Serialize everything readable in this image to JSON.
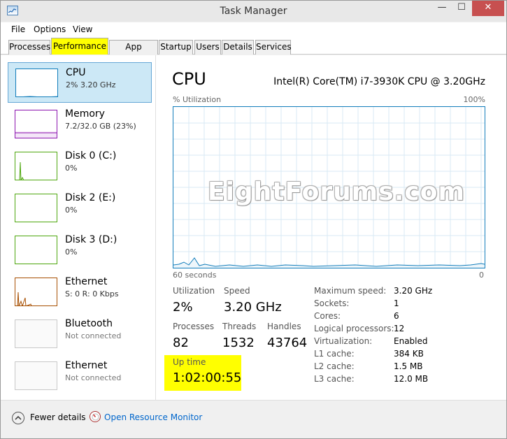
{
  "window": {
    "title": "Task Manager",
    "controls": {
      "minimize": "—",
      "maximize": "☐",
      "close": "✕"
    }
  },
  "menu": {
    "items": [
      "File",
      "Options",
      "View"
    ]
  },
  "tabs": [
    "Processes",
    "Performance",
    "App history",
    "Startup",
    "Users",
    "Details",
    "Services"
  ],
  "active_tab": "Performance",
  "sidebar": {
    "items": [
      {
        "name": "CPU",
        "sub": "2% 3.20 GHz",
        "selected": true,
        "color": "#117dbb"
      },
      {
        "name": "Memory",
        "sub": "7.2/32.0 GB (23%)",
        "color": "#8b12ae"
      },
      {
        "name": "Disk 0 (C:)",
        "sub": "0%",
        "color": "#4da60c"
      },
      {
        "name": "Disk 2 (E:)",
        "sub": "0%",
        "color": "#4da60c"
      },
      {
        "name": "Disk 3 (D:)",
        "sub": "0%",
        "color": "#4da60c"
      },
      {
        "name": "Ethernet",
        "sub": "S: 0 R: 0 Kbps",
        "color": "#a74f01"
      },
      {
        "name": "Bluetooth",
        "sub": "Not connected",
        "color": "#999999"
      },
      {
        "name": "Ethernet",
        "sub": "Not connected",
        "color": "#999999"
      }
    ]
  },
  "main": {
    "title": "CPU",
    "model": "Intel(R) Core(TM) i7-3930K CPU @ 3.20GHz",
    "graph": {
      "label_left": "% Utilization",
      "label_right": "100%",
      "axis_left": "60 seconds",
      "axis_right": "0",
      "line_color": "#117dbb",
      "grid_color": "#d9eaf4"
    },
    "stats": {
      "utilization_label": "Utilization",
      "utilization_value": "2%",
      "speed_label": "Speed",
      "speed_value": "3.20 GHz",
      "processes_label": "Processes",
      "processes_value": "82",
      "threads_label": "Threads",
      "threads_value": "1532",
      "handles_label": "Handles",
      "handles_value": "43764",
      "uptime_label": "Up time",
      "uptime_value": "1:02:00:55"
    },
    "info": [
      {
        "key": "Maximum speed:",
        "value": "3.20 GHz"
      },
      {
        "key": "Sockets:",
        "value": "1"
      },
      {
        "key": "Cores:",
        "value": "6"
      },
      {
        "key": "Logical processors:",
        "value": "12"
      },
      {
        "key": "Virtualization:",
        "value": "Enabled"
      },
      {
        "key": "L1 cache:",
        "value": "384 KB"
      },
      {
        "key": "L2 cache:",
        "value": "1.5 MB"
      },
      {
        "key": "L3 cache:",
        "value": "12.0 MB"
      }
    ]
  },
  "watermark": "EightForums.com",
  "footer": {
    "fewer_details": "Fewer details",
    "open_resource_monitor": "Open Resource Monitor"
  },
  "highlight_color": "#ffff00"
}
